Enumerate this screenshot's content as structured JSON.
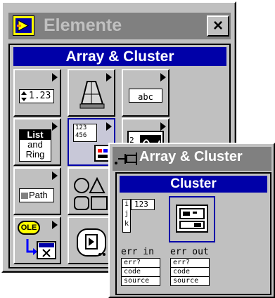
{
  "window": {
    "title": "Elemente",
    "close_label": "×",
    "palette_header": "Array & Cluster",
    "items": [
      {
        "name": "numeric",
        "icon_text": "1.23"
      },
      {
        "name": "boolean",
        "icon_text": ""
      },
      {
        "name": "string",
        "icon_text": "abc"
      },
      {
        "name": "list-and-ring",
        "line1": "List",
        "line2": "and",
        "line3": "Ring"
      },
      {
        "name": "array-and-cluster",
        "icon_text": "123 456"
      },
      {
        "name": "graph",
        "icon_text": "2"
      },
      {
        "name": "path",
        "icon_text": "Path"
      },
      {
        "name": "decorations",
        "icon_text": ""
      },
      {
        "name": "ole",
        "icon_text": "OLE"
      },
      {
        "name": "refnum",
        "icon_text": ""
      }
    ]
  },
  "subpalette": {
    "title": "Array & Cluster",
    "header": "Cluster",
    "array_icon": {
      "index_letters": [
        "i",
        "j",
        "k"
      ],
      "value": "123"
    },
    "err_in": {
      "label": "err in",
      "fields": [
        "err?",
        "code",
        "source"
      ]
    },
    "err_out": {
      "label": "err out",
      "fields": [
        "err?",
        "code",
        "source"
      ]
    }
  },
  "colors": {
    "header_blue": "#0000a8",
    "face": "#c0c0c0",
    "title_gray": "#808080"
  }
}
